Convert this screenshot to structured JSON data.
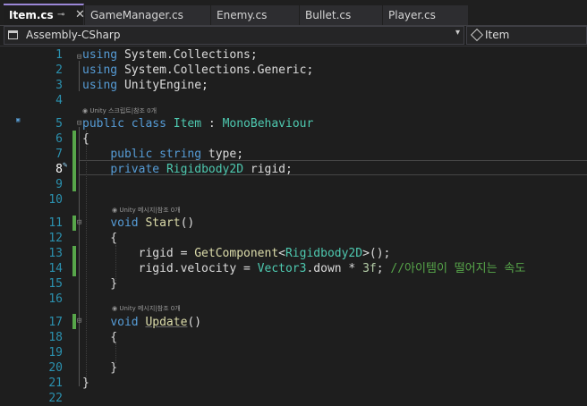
{
  "tabs": [
    {
      "label": "Item.cs",
      "active": true,
      "pin": "⊸",
      "close": "✕"
    },
    {
      "label": "GameManager.cs"
    },
    {
      "label": "Enemy.cs"
    },
    {
      "label": "Bullet.cs"
    },
    {
      "label": "Player.cs"
    }
  ],
  "nav": {
    "project": "Assembly-CSharp",
    "dropdown_arrow": "▾",
    "member": "Item"
  },
  "lens": {
    "class_refs": "Unity 스크립트|참조 0개",
    "method_refs": "Unity 메시지|참조 0개",
    "unity": "Unity"
  },
  "lines": [
    {
      "n": "1",
      "tokens": [
        [
          "kw",
          "using"
        ],
        [
          "pl",
          " System.Collections;"
        ]
      ]
    },
    {
      "n": "2",
      "tokens": [
        [
          "kw",
          "using"
        ],
        [
          "pl",
          " System.Collections.Generic;"
        ]
      ]
    },
    {
      "n": "3",
      "tokens": [
        [
          "kw",
          "using"
        ],
        [
          "pl",
          " UnityEngine;"
        ]
      ]
    },
    {
      "n": "4",
      "tokens": []
    },
    {
      "n": "5",
      "tokens": [
        [
          "kw",
          "public"
        ],
        [
          "pl",
          " "
        ],
        [
          "kw",
          "class"
        ],
        [
          "pl",
          " "
        ],
        [
          "typ",
          "Item"
        ],
        [
          "pl",
          " : "
        ],
        [
          "typ",
          "MonoBehaviour"
        ]
      ]
    },
    {
      "n": "6",
      "tokens": [
        [
          "pl",
          "{"
        ]
      ]
    },
    {
      "n": "7",
      "tokens": [
        [
          "pl",
          "    "
        ],
        [
          "kw",
          "public"
        ],
        [
          "pl",
          " "
        ],
        [
          "kw",
          "string"
        ],
        [
          "pl",
          " type;"
        ]
      ]
    },
    {
      "n": "8",
      "tokens": [
        [
          "pl",
          "    "
        ],
        [
          "kw",
          "private"
        ],
        [
          "pl",
          " "
        ],
        [
          "typ",
          "Rigidbody2D"
        ],
        [
          "pl",
          " rigid;"
        ]
      ]
    },
    {
      "n": "9",
      "tokens": []
    },
    {
      "n": "10",
      "tokens": []
    },
    {
      "n": "11",
      "tokens": [
        [
          "pl",
          "    "
        ],
        [
          "kw",
          "void"
        ],
        [
          "pl",
          " "
        ],
        [
          "fn",
          "Start"
        ],
        [
          "pl",
          "()"
        ]
      ]
    },
    {
      "n": "12",
      "tokens": [
        [
          "pl",
          "    {"
        ]
      ]
    },
    {
      "n": "13",
      "tokens": [
        [
          "pl",
          "        rigid = "
        ],
        [
          "fn",
          "GetComponent"
        ],
        [
          "pl",
          "<"
        ],
        [
          "typ",
          "Rigidbody2D"
        ],
        [
          "pl",
          ">();"
        ]
      ]
    },
    {
      "n": "14",
      "tokens": [
        [
          "pl",
          "        rigid.velocity = "
        ],
        [
          "typ",
          "Vector3"
        ],
        [
          "pl",
          ".down * "
        ],
        [
          "num",
          "3f"
        ],
        [
          "pl",
          "; "
        ],
        [
          "cmt",
          "//아이템이 떨어지는 속도"
        ]
      ]
    },
    {
      "n": "15",
      "tokens": [
        [
          "pl",
          "    }"
        ]
      ]
    },
    {
      "n": "16",
      "tokens": []
    },
    {
      "n": "17",
      "tokens": [
        [
          "pl",
          "    "
        ],
        [
          "kw",
          "void"
        ],
        [
          "pl",
          " "
        ],
        [
          "fn ul",
          "Update"
        ],
        [
          "pl",
          "()"
        ]
      ]
    },
    {
      "n": "18",
      "tokens": [
        [
          "pl",
          "    {"
        ]
      ]
    },
    {
      "n": "19",
      "tokens": []
    },
    {
      "n": "20",
      "tokens": [
        [
          "pl",
          "    }"
        ]
      ]
    },
    {
      "n": "21",
      "tokens": [
        [
          "pl",
          "}"
        ]
      ]
    },
    {
      "n": "22",
      "tokens": []
    }
  ]
}
